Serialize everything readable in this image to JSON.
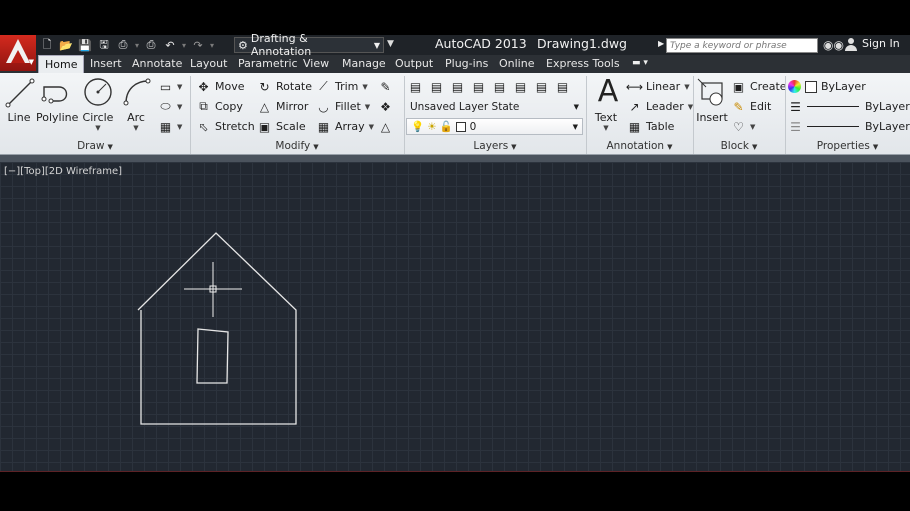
{
  "titlebar": {
    "workspace": "Drafting & Annotation",
    "app_title": "AutoCAD 2013",
    "doc_title": "Drawing1.dwg",
    "search_placeholder": "Type a keyword or phrase",
    "sign_in": "Sign In"
  },
  "tabs": [
    {
      "label": "Home",
      "active": true
    },
    {
      "label": "Insert"
    },
    {
      "label": "Annotate"
    },
    {
      "label": "Layout"
    },
    {
      "label": "Parametric"
    },
    {
      "label": "View"
    },
    {
      "label": "Manage"
    },
    {
      "label": "Output"
    },
    {
      "label": "Plug-ins"
    },
    {
      "label": "Online"
    },
    {
      "label": "Express Tools"
    }
  ],
  "ribbon": {
    "draw": {
      "title": "Draw",
      "line": "Line",
      "polyline": "Polyline",
      "circle": "Circle",
      "arc": "Arc"
    },
    "modify": {
      "title": "Modify",
      "move": "Move",
      "rotate": "Rotate",
      "trim": "Trim",
      "copy": "Copy",
      "mirror": "Mirror",
      "fillet": "Fillet",
      "stretch": "Stretch",
      "scale": "Scale",
      "array": "Array"
    },
    "layers": {
      "title": "Layers",
      "layer_state": "Unsaved Layer State",
      "current_layer": "0"
    },
    "annotation": {
      "title": "Annotation",
      "text": "Text",
      "linear": "Linear",
      "leader": "Leader",
      "table": "Table"
    },
    "block": {
      "title": "Block",
      "insert": "Insert",
      "create": "Create",
      "edit": "Edit"
    },
    "properties": {
      "title": "Properties",
      "color": "ByLayer",
      "lineweight": "ByLayer",
      "linetype": "ByLayer"
    }
  },
  "viewport": {
    "label": "[−][Top][2D Wireframe]"
  },
  "colors": {
    "canvas_bg": "#222831",
    "drawing_line": "#e6e6e6",
    "ribbon_bg": "#e9ecef",
    "title_bg": "#1f2328"
  }
}
